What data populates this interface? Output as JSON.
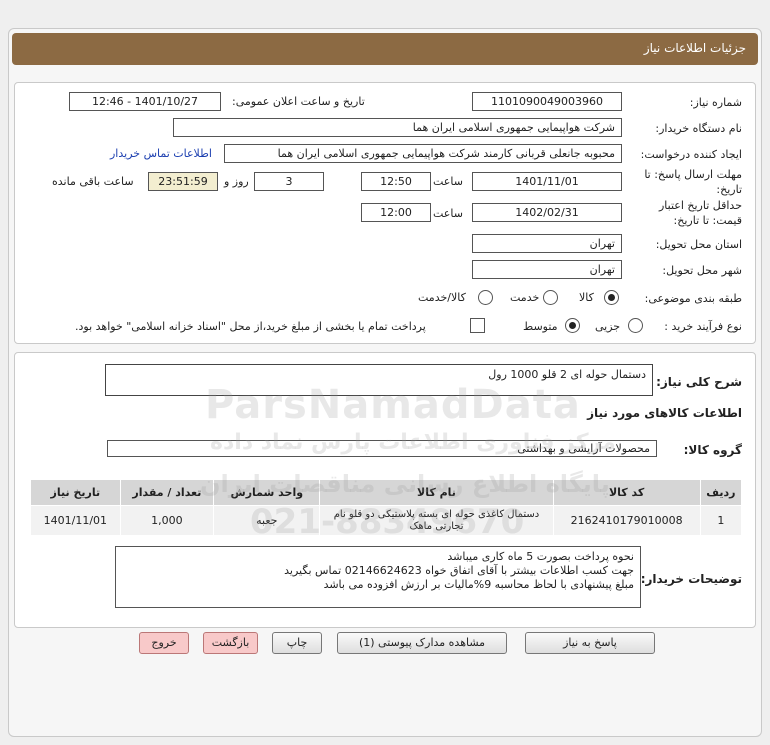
{
  "header": {
    "title": "جزئیات اطلاعات نیاز"
  },
  "form": {
    "need_number_label": "شماره نیاز:",
    "need_number": "1101090049003960",
    "announce_label": "تاریخ و ساعت اعلان عمومی:",
    "announce_value": "1401/10/27 - 12:46",
    "buyer_org_label": "نام دستگاه خریدار:",
    "buyer_org": "شرکت هواپیمایی جمهوری اسلامی ایران هما",
    "requester_label": "ایجاد کننده درخواست:",
    "requester": "محبوبه جانعلی قربانی کارمند شرکت هواپیمایی جمهوری اسلامی ایران هما",
    "contact_link": "اطلاعات تماس خریدار",
    "deadline_label_1": "مهلت ارسال پاسخ: تا",
    "deadline_label_2": "تاریخ:",
    "deadline_date": "1401/11/01",
    "time_label": "ساعت",
    "deadline_time": "12:50",
    "days_value": "3",
    "days_label": "روز و",
    "remaining_time": "23:51:59",
    "remaining_label": "ساعت باقی مانده",
    "validity_label_1": "حداقل تاریخ اعتبار",
    "validity_label_2": "قیمت: تا تاریخ:",
    "validity_date": "1402/02/31",
    "validity_time": "12:00",
    "province_label": "استان محل تحویل:",
    "province": "تهران",
    "city_label": "شهر محل تحویل:",
    "city": "تهران",
    "category_label": "طبقه بندی موضوعی:",
    "category_options": [
      "کالا",
      "خدمت",
      "کالا/خدمت"
    ],
    "process_label": "نوع فرآیند خرید :",
    "process_options": [
      "جزیی",
      "متوسط"
    ],
    "treasury_note": "پرداخت تمام یا بخشی از مبلغ خرید،از محل \"اسناد خزانه اسلامی\" خواهد بود."
  },
  "description": {
    "label": "شرح کلی نیاز:",
    "value": "دستمال حوله ای 2 قلو  1000 رول"
  },
  "goods": {
    "section_title": "اطلاعات کالاهای مورد نیاز",
    "group_label": "گروه کالا:",
    "group_value": "محصولات آرایشی و بهداشتی",
    "headers": [
      "ردیف",
      "کد کالا",
      "نام کالا",
      "واحد شمارش",
      "تعداد / مقدار",
      "تاریخ نیاز"
    ],
    "rows": [
      [
        "1",
        "2162410179010008",
        "دستمال کاغذی حوله ای بسته پلاستیکی دو قلو نام تجارتی ماهک",
        "جعبه",
        "1,000",
        "1401/11/01"
      ]
    ]
  },
  "notes": {
    "label": "توضیحات خریدار:",
    "lines": [
      "نحوه پرداخت بصورت 5 ماه کاری میباشد",
      "جهت کسب اطلاعات بیشتر با آقای اتفاق خواه  02146624623 تماس بگیرید",
      "مبلغ پیشنهادی با لحاظ محاسبه 9%مالیات بر ارزش افزوده می باشد"
    ]
  },
  "buttons": {
    "reply": "پاسخ به نیاز",
    "attachments": "مشاهده مدارک پیوستی (1)",
    "print": "چاپ",
    "back": "بازگشت",
    "exit": "خروج"
  },
  "watermark": {
    "brand": "ParsNamadData",
    "fa_line1": "مرکز فناوری اطلاعات پارس نماد داده",
    "fa_line2": "پایگاه اطلاع رسانی مناقصات ایران",
    "phone": "021-88349670"
  }
}
